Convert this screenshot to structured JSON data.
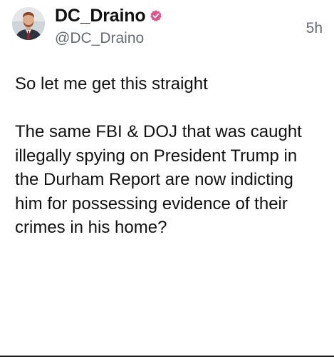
{
  "post": {
    "author": {
      "display_name": "DC_Draino",
      "handle": "@DC_Draino",
      "verified_icon": "verified-badge-icon",
      "avatar": "avatar"
    },
    "timestamp": "5h",
    "text": "So let me get this straight\n\nThe same FBI & DOJ that was caught illegally spying on President Trump in the Durham Report are now indicting him for possessing evidence of their crimes in his home?"
  },
  "colors": {
    "text": "#111111",
    "secondary_text": "#666b70",
    "verified_badge": "#d9558b",
    "background": "#ffffff"
  }
}
